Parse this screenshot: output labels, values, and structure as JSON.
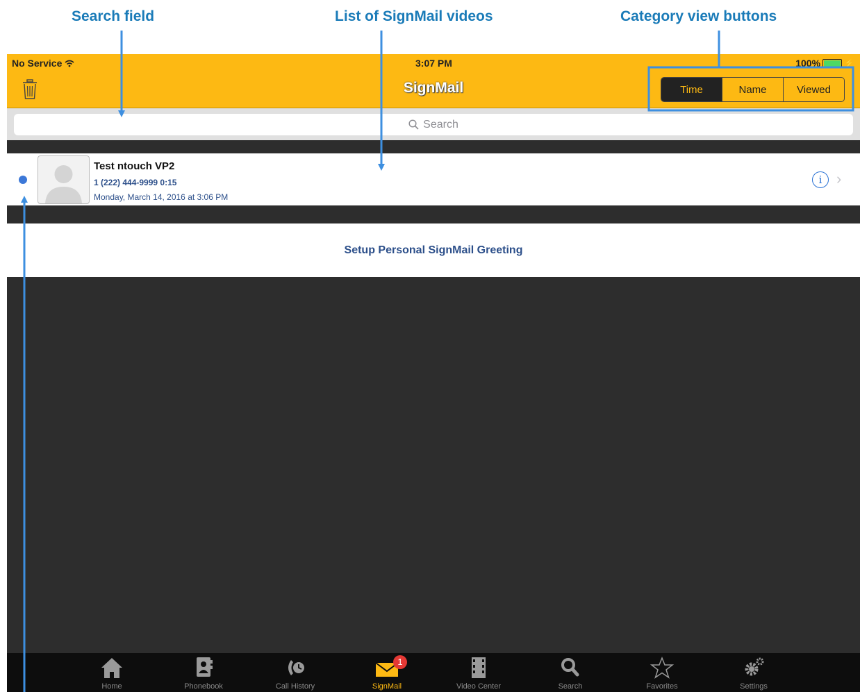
{
  "callouts": {
    "search": "Search field",
    "list": "List of SignMail videos",
    "category": "Category view buttons"
  },
  "status_bar": {
    "carrier": "No Service",
    "time": "3:07 PM",
    "battery": "100%"
  },
  "header": {
    "title": "SignMail",
    "segments": [
      "Time",
      "Name",
      "Viewed"
    ],
    "selected_segment": "Time"
  },
  "search": {
    "placeholder": "Search"
  },
  "signmail_list": [
    {
      "name": "Test ntouch VP2",
      "meta": "1 (222) 444-9999  0:15",
      "date": "Monday, March 14, 2016 at 3:06 PM",
      "unread": true
    }
  ],
  "greeting": {
    "label": "Setup Personal SignMail Greeting"
  },
  "tabs": [
    {
      "label": "Home",
      "icon": "home-icon"
    },
    {
      "label": "Phonebook",
      "icon": "phonebook-icon"
    },
    {
      "label": "Call History",
      "icon": "call-history-icon"
    },
    {
      "label": "SignMail",
      "icon": "signmail-icon",
      "badge": "1",
      "active": true
    },
    {
      "label": "Video Center",
      "icon": "video-center-icon"
    },
    {
      "label": "Search",
      "icon": "search-icon"
    },
    {
      "label": "Favorites",
      "icon": "favorites-icon"
    },
    {
      "label": "Settings",
      "icon": "settings-icon"
    }
  ],
  "colors": {
    "brand_yellow": "#fdb913",
    "callout_blue": "#1a7bb8",
    "link_blue": "#2c4f8a"
  }
}
